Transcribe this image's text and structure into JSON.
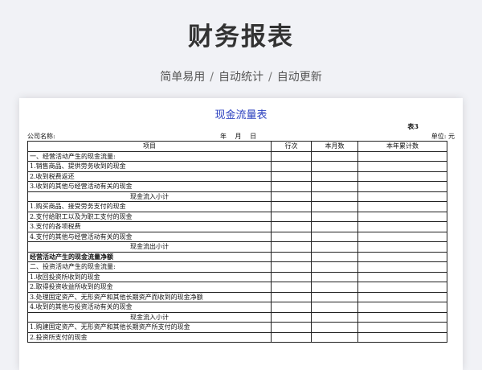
{
  "header": {
    "title": "财务报表",
    "features": [
      "简单易用",
      "自动统计",
      "自动更新"
    ],
    "separator": "/"
  },
  "document": {
    "title": "现金流量表",
    "form_number": "表3",
    "company_label": "公司名称:",
    "date_label": "年 月 日",
    "unit_label": "单位: 元",
    "columns": [
      "项目",
      "行次",
      "本月数",
      "本年累计数"
    ],
    "rows": [
      {
        "item": "一、经营活动产生的现金流量:",
        "style": "left"
      },
      {
        "item": "1.销售商品、提供劳务收到的现金",
        "style": "left"
      },
      {
        "item": "2.收到税费返还",
        "style": "left"
      },
      {
        "item": "3.收到的其他与经营活动有关的现金",
        "style": "left"
      },
      {
        "item": "现金流入小计",
        "style": "center"
      },
      {
        "item": "1.购买商品、接受劳务支付的现金",
        "style": "left"
      },
      {
        "item": "2.支付给职工以及为职工支付的现金",
        "style": "left"
      },
      {
        "item": "3.支付的各项税费",
        "style": "left"
      },
      {
        "item": "4.支付的其他与经营活动有关的现金",
        "style": "left"
      },
      {
        "item": "现金流出小计",
        "style": "center"
      },
      {
        "item": "经营活动产生的现金流量净额",
        "style": "bold"
      },
      {
        "item": "二、投资活动产生的现金流量:",
        "style": "left"
      },
      {
        "item": "1.收回投资所收到的现金",
        "style": "left"
      },
      {
        "item": "2.取得投资收益所收到的现金",
        "style": "left"
      },
      {
        "item": "3.处理固定资产、无形资产和其他长期资产而收到的现金净额",
        "style": "left"
      },
      {
        "item": "4.收到的其他与投资活动有关的现金",
        "style": "left"
      },
      {
        "item": "现金流入小计",
        "style": "center"
      },
      {
        "item": "1.购建固定资产、无形资产和其他长期资产所支付的现金",
        "style": "left"
      },
      {
        "item": "2.投资所支付的现金",
        "style": "left"
      }
    ]
  }
}
